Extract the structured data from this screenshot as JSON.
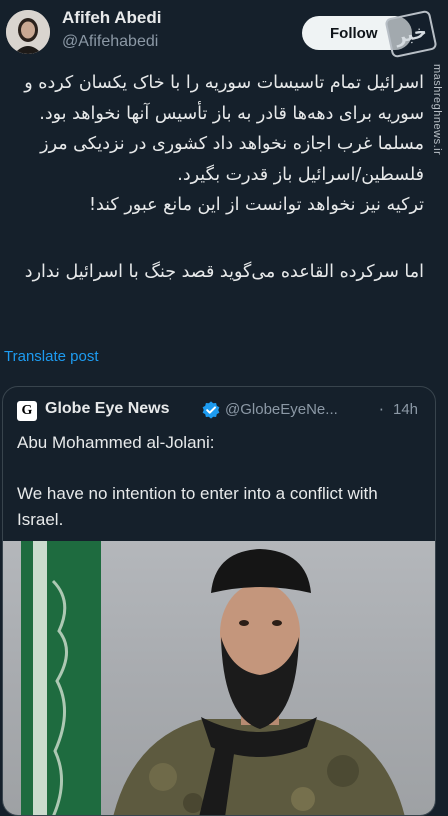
{
  "header": {
    "display_name": "Afifeh Abedi",
    "handle": "@Afifehabedi",
    "follow_label": "Follow",
    "logo_text": "ﺧﺒﺮ"
  },
  "watermark": "mashreghnews.ir",
  "post": {
    "paragraph1": "اسرائیل تمام تاسیسات سوریه را با خاک یکسان کرده و سوریه برای دهه‌ها قادر به باز تأسیس آنها نخواهد بود. مسلما غرب اجازه نخواهد داد کشوری در نزدیکی مرز فلسطین/اسرائیل باز قدرت بگیرد.",
    "paragraph2": "ترکیه نیز نخواهد توانست از این مانع عبور کند!",
    "paragraph3": "اما سرکرده القاعده می‌گوید قصد جنگ با اسرائیل ندارد"
  },
  "translate_label": "Translate post",
  "quote": {
    "logo_letter": "G",
    "name": "Globe Eye News",
    "handle": "@GlobeEyeNe...",
    "dot": "·",
    "time": "14h",
    "line1": "Abu Mohammed al-Jolani:",
    "line2": "We have no intention to enter into a conflict with Israel.",
    "verified_color": "#1d9bf0"
  },
  "icons": {
    "verified": "verified-badge-icon",
    "avatar": "avatar"
  }
}
